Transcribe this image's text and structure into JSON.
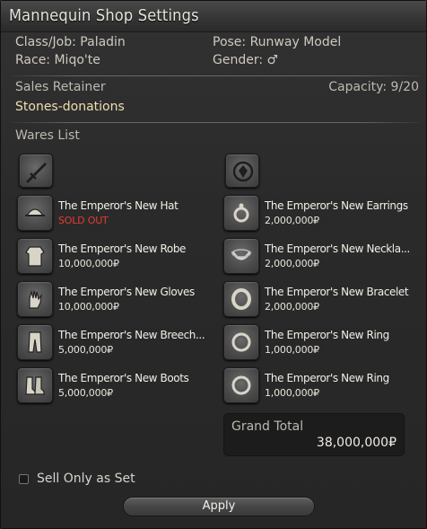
{
  "window": {
    "title": "Mannequin Shop Settings"
  },
  "info": {
    "class_job": "Class/Job: Paladin",
    "race": "Race: Miqo'te",
    "pose": "Pose: Runway Model",
    "gender": "Gender: ♂"
  },
  "retainer": {
    "section_label": "Sales Retainer",
    "capacity": "Capacity: 9/20",
    "name": "Stones-donations"
  },
  "wares": {
    "section_label": "Wares List",
    "left_category_icon": "sword-icon",
    "right_category_icon": "accessory-icon",
    "left": [
      {
        "name": "The Emperor's New Hat",
        "price": "SOLD OUT",
        "sold_out": true,
        "icon": "hat-icon"
      },
      {
        "name": "The Emperor's New Robe",
        "price": "10,000,000₽",
        "icon": "robe-icon"
      },
      {
        "name": "The Emperor's New Gloves",
        "price": "10,000,000₽",
        "icon": "gloves-icon"
      },
      {
        "name": "The Emperor's New Breech...",
        "price": "5,000,000₽",
        "icon": "breeches-icon"
      },
      {
        "name": "The Emperor's New Boots",
        "price": "5,000,000₽",
        "icon": "boots-icon"
      }
    ],
    "right": [
      {
        "name": "The Emperor's New Earrings",
        "price": "2,000,000₽",
        "icon": "earrings-icon"
      },
      {
        "name": "The Emperor's New Neckla...",
        "price": "2,000,000₽",
        "icon": "necklace-icon"
      },
      {
        "name": "The Emperor's New Bracelet",
        "price": "2,000,000₽",
        "icon": "bracelet-icon"
      },
      {
        "name": "The Emperor's New Ring",
        "price": "1,000,000₽",
        "icon": "ring-icon"
      },
      {
        "name": "The Emperor's New Ring",
        "price": "1,000,000₽",
        "icon": "ring-icon"
      }
    ]
  },
  "total": {
    "label": "Grand Total",
    "value": "38,000,000₽"
  },
  "options": {
    "sell_only_as_set": "Sell Only as Set",
    "sell_only_as_set_checked": false
  },
  "actions": {
    "apply_label": "Apply"
  },
  "colors": {
    "sold_out": "#e23c32",
    "retainer_name": "#f0deb0",
    "background": "#2b2b2b"
  }
}
